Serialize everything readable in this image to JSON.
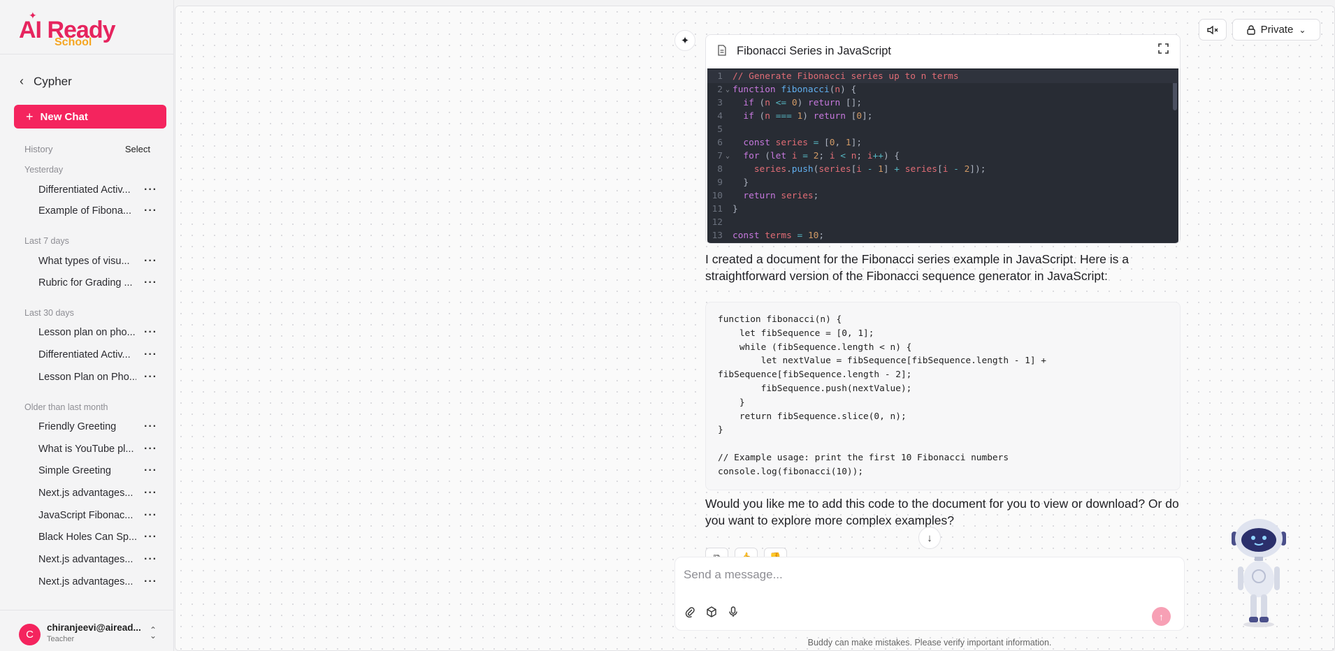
{
  "brand": {
    "ai": "AI Ready",
    "school": "School"
  },
  "sidebar": {
    "back_title": "Cypher",
    "new_chat": "New Chat",
    "history_label": "History",
    "select_label": "Select",
    "groups": [
      {
        "label": "Yesterday",
        "items": [
          "Differentiated Activ...",
          "Example of Fibona..."
        ]
      },
      {
        "label": "Last 7 days",
        "items": [
          "What types of visu...",
          "Rubric for Grading ..."
        ]
      },
      {
        "label": "Last 30 days",
        "items": [
          "Lesson plan on pho...",
          "Differentiated Activ...",
          "Lesson Plan on Pho..."
        ]
      },
      {
        "label": "Older than last month",
        "items": [
          "Friendly Greeting",
          "What is YouTube pl...",
          "Simple Greeting",
          "Next.js advantages...",
          "JavaScript Fibonac...",
          "Black Holes Can Sp...",
          "Next.js advantages...",
          "Next.js advantages..."
        ]
      }
    ],
    "user": {
      "initial": "C",
      "email": "chiranjeevi@airead...",
      "role": "Teacher"
    }
  },
  "header": {
    "private_label": "Private"
  },
  "document": {
    "title": "Fibonacci Series in JavaScript",
    "lines": [
      "1",
      "2",
      "3",
      "4",
      "5",
      "6",
      "7",
      "8",
      "9",
      "10",
      "11",
      "12",
      "13"
    ]
  },
  "messages": {
    "intro": "I created a document for the Fibonacci series example in JavaScript. Here is a straightforward version of the Fibonacci sequence generator in JavaScript:",
    "code": "function fibonacci(n) {\n    let fibSequence = [0, 1];\n    while (fibSequence.length < n) {\n        let nextValue = fibSequence[fibSequence.length - 1] +\nfibSequence[fibSequence.length - 2];\n        fibSequence.push(nextValue);\n    }\n    return fibSequence.slice(0, n);\n}\n\n// Example usage: print the first 10 Fibonacci numbers\nconsole.log(fibonacci(10));",
    "followup": "Would you like me to add this code to the document for you to view or download? Or do you want to explore more complex examples?"
  },
  "composer": {
    "placeholder": "Send a message..."
  },
  "disclaimer": "Buddy can make mistakes. Please verify important information.",
  "colors": {
    "accent": "#f4245e",
    "brand_orange": "#f5a623",
    "editor_bg": "#282c34"
  }
}
